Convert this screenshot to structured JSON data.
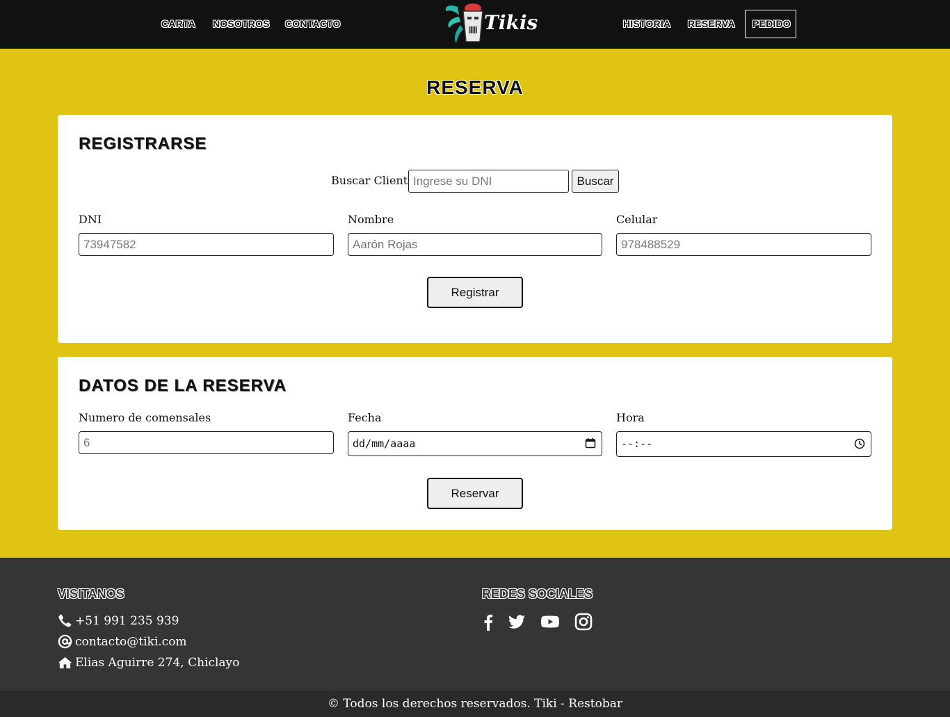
{
  "nav": {
    "left": [
      "CARTA",
      "NOSOTROS",
      "CONTACTO"
    ],
    "right": [
      "HISTORIA",
      "RESERVA",
      "PEDIDO"
    ],
    "logo_text": "Tikis"
  },
  "page_title": "RESERVA",
  "register": {
    "title": "REGISTRARSE",
    "search_label": "Buscar Cliente",
    "search_placeholder": "Ingrese su DNI",
    "search_button": "Buscar",
    "dni_label": "DNI",
    "dni_value": "73947582",
    "name_label": "Nombre",
    "name_value": "Aarón Rojas",
    "phone_label": "Celular",
    "phone_value": "978488529",
    "submit": "Registrar"
  },
  "booking": {
    "title": "DATOS DE LA RESERVA",
    "guests_label": "Numero de comensales",
    "guests_value": "6",
    "date_label": "Fecha",
    "date_value": "dd/mm/aaaa",
    "time_label": "Hora",
    "time_value": "--:--",
    "submit": "Reservar"
  },
  "footer": {
    "visit_title": "VISITANOS",
    "phone": "+51 991 235 939",
    "email": "contacto@tiki.com",
    "address": "Elias Aguirre 274, Chiclayo",
    "social_title": "REDES SOCIALES",
    "social_icons": [
      "facebook-icon",
      "twitter-icon",
      "youtube-icon",
      "instagram-icon"
    ],
    "copyright": "© Todos los derechos reservados. Tiki - Restobar"
  },
  "colors": {
    "background": "#e0c414",
    "navbar": "#111111",
    "footer": "#353535",
    "copyright_bar": "#2a2a2a"
  }
}
